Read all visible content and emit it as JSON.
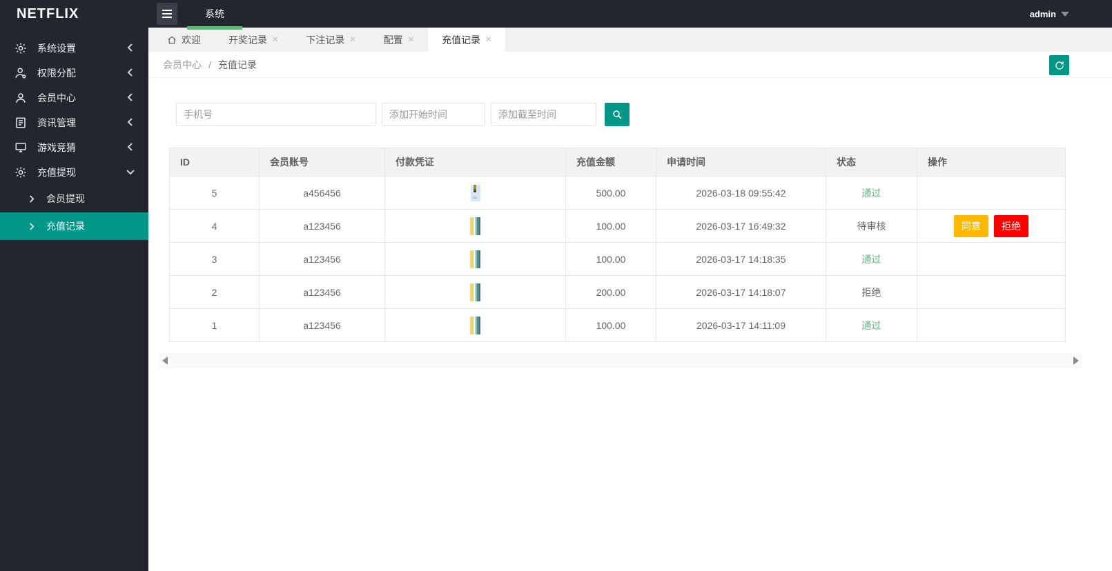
{
  "header": {
    "logo": "NETFLIX",
    "nav_system": "系统",
    "user": "admin"
  },
  "sidebar": {
    "items": [
      {
        "label": "系统设置",
        "icon": "gear-icon",
        "expanded": false
      },
      {
        "label": "权限分配",
        "icon": "user-permission-icon",
        "expanded": false
      },
      {
        "label": "会员中心",
        "icon": "user-icon",
        "expanded": false
      },
      {
        "label": "资讯管理",
        "icon": "document-icon",
        "expanded": false
      },
      {
        "label": "游戏竞猜",
        "icon": "monitor-icon",
        "expanded": false
      },
      {
        "label": "充值提现",
        "icon": "gear-icon",
        "expanded": true,
        "children": [
          {
            "label": "会员提现",
            "active": false
          },
          {
            "label": "充值记录",
            "active": true
          }
        ]
      }
    ]
  },
  "tabs": [
    {
      "label": "欢迎",
      "icon": "home-icon",
      "closable": false,
      "active": false
    },
    {
      "label": "开奖记录",
      "closable": true,
      "active": false
    },
    {
      "label": "下注记录",
      "closable": true,
      "active": false
    },
    {
      "label": "配置",
      "closable": true,
      "active": false
    },
    {
      "label": "充值记录",
      "closable": true,
      "active": true
    }
  ],
  "close_glyph": "×",
  "breadcrumb": {
    "parent": "会员中心",
    "separator": "/",
    "current": "充值记录"
  },
  "search": {
    "phone_placeholder": "手机号",
    "start_placeholder": "添加开始时间",
    "end_placeholder": "添加截至时间"
  },
  "table": {
    "columns": [
      "ID",
      "会员账号",
      "付款凭证",
      "充值金额",
      "申请时间",
      "状态",
      "操作"
    ],
    "rows": [
      {
        "id": "5",
        "account": "a456456",
        "thumb": "light",
        "amount": "500.00",
        "time": "2026-03-18 09:55:42",
        "status": "通过",
        "status_type": "pass",
        "actions": []
      },
      {
        "id": "4",
        "account": "a123456",
        "thumb": "color",
        "amount": "100.00",
        "time": "2026-03-17 16:49:32",
        "status": "待审核",
        "status_type": "pending",
        "actions": [
          {
            "name": "agree",
            "label": "同意",
            "color": "#FFB800"
          },
          {
            "name": "reject",
            "label": "拒绝",
            "color": "#FF0000"
          }
        ]
      },
      {
        "id": "3",
        "account": "a123456",
        "thumb": "color",
        "amount": "100.00",
        "time": "2026-03-17 14:18:35",
        "status": "通过",
        "status_type": "pass",
        "actions": []
      },
      {
        "id": "2",
        "account": "a123456",
        "thumb": "color",
        "amount": "200.00",
        "time": "2026-03-17 14:18:07",
        "status": "拒绝",
        "status_type": "reject",
        "actions": []
      },
      {
        "id": "1",
        "account": "a123456",
        "thumb": "color",
        "amount": "100.00",
        "time": "2026-03-17 14:11:09",
        "status": "通过",
        "status_type": "pass",
        "actions": []
      }
    ]
  },
  "colors": {
    "accent_teal": "#009688",
    "active_green": "#5FB878",
    "agree_yellow": "#FFB800",
    "reject_red": "#FF0000",
    "header_dark": "#23262E"
  }
}
